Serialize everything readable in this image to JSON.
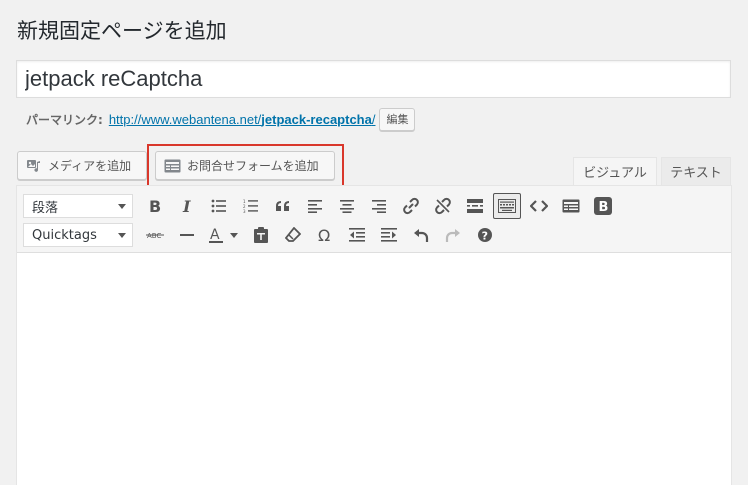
{
  "page": {
    "title": "新規固定ページを追加"
  },
  "post": {
    "title_value": "jetpack reCaptcha"
  },
  "permalink": {
    "label": "パーマリンク:",
    "url_base": "http://www.webantena.net/",
    "slug": "jetpack-recaptcha",
    "url_end": "/",
    "edit_label": "編集"
  },
  "media": {
    "add_media_label": "メディアを追加",
    "add_form_label": "お問合せフォームを追加"
  },
  "tabs": {
    "visual": "ビジュアル",
    "text": "テキスト"
  },
  "toolbar": {
    "format_select": "段落",
    "font_select": "Quicktags",
    "row1_icons": [
      "bold-icon",
      "italic-icon",
      "bulleted-list-icon",
      "numbered-list-icon",
      "blockquote-icon",
      "align-left-icon",
      "align-center-icon",
      "align-right-icon",
      "link-icon",
      "unlink-icon",
      "read-more-icon",
      "toolbar-toggle-icon",
      "code-icon",
      "form-icon",
      "b-icon"
    ],
    "row2_icons": [
      "strikethrough-icon",
      "horizontal-line-icon",
      "text-color-icon",
      "paste-text-icon",
      "clear-formatting-icon",
      "special-character-icon",
      "outdent-icon",
      "indent-icon",
      "undo-icon",
      "redo-icon",
      "help-icon"
    ],
    "strikethrough_label": "ABC",
    "text_color_label": "A",
    "omega_label": "Ω",
    "b_label": "B",
    "help_label": "?"
  },
  "colors": {
    "accent": "#0073aa",
    "highlight": "#d9372b",
    "icon": "#555555"
  }
}
